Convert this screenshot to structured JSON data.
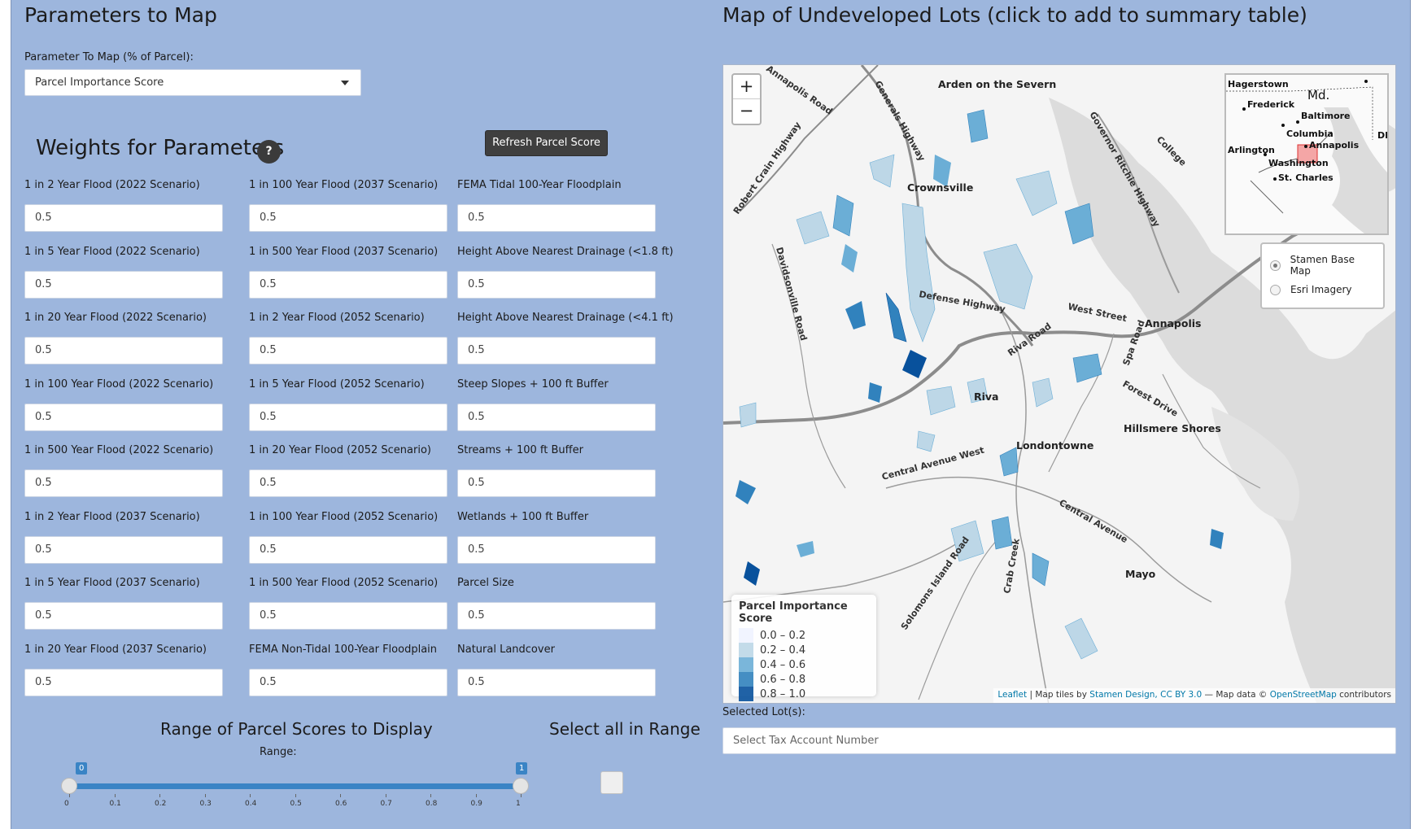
{
  "left_panel": {
    "title": "Parameters to Map",
    "param_select_label": "Parameter To Map (% of Parcel):",
    "param_select_value": "Parcel Importance Score",
    "weights_title": "Weights for Parameters",
    "help_label": "?",
    "refresh_button": "Refresh Parcel Score",
    "fields": [
      {
        "label": "1 in 2 Year Flood (2022 Scenario)",
        "value": "0.5"
      },
      {
        "label": "1 in 100 Year Flood (2037 Scenario)",
        "value": "0.5"
      },
      {
        "label": "FEMA Tidal 100-Year Floodplain",
        "value": "0.5"
      },
      {
        "label": "1 in 5 Year Flood (2022 Scenario)",
        "value": "0.5"
      },
      {
        "label": "1 in 500 Year Flood (2037 Scenario)",
        "value": "0.5"
      },
      {
        "label": "Height Above Nearest Drainage (<1.8 ft)",
        "value": "0.5"
      },
      {
        "label": "1 in 20 Year Flood (2022 Scenario)",
        "value": "0.5"
      },
      {
        "label": "1 in 2 Year Flood (2052 Scenario)",
        "value": "0.5"
      },
      {
        "label": "Height Above Nearest Drainage (<4.1 ft)",
        "value": "0.5"
      },
      {
        "label": "1 in 100 Year Flood (2022 Scenario)",
        "value": "0.5"
      },
      {
        "label": "1 in 5 Year Flood (2052 Scenario)",
        "value": "0.5"
      },
      {
        "label": "Steep Slopes + 100 ft Buffer",
        "value": "0.5"
      },
      {
        "label": "1 in 500 Year Flood (2022 Scenario)",
        "value": "0.5"
      },
      {
        "label": "1 in 20 Year Flood (2052 Scenario)",
        "value": "0.5"
      },
      {
        "label": "Streams + 100 ft Buffer",
        "value": "0.5"
      },
      {
        "label": "1 in 2 Year Flood (2037 Scenario)",
        "value": "0.5"
      },
      {
        "label": "1 in 100 Year Flood (2052 Scenario)",
        "value": "0.5"
      },
      {
        "label": "Wetlands + 100 ft Buffer",
        "value": "0.5"
      },
      {
        "label": "1 in 5 Year Flood (2037 Scenario)",
        "value": "0.5"
      },
      {
        "label": "1 in 500 Year Flood (2052 Scenario)",
        "value": "0.5"
      },
      {
        "label": "Parcel Size",
        "value": "0.5"
      },
      {
        "label": "1 in 20 Year Flood (2037 Scenario)",
        "value": "0.5"
      },
      {
        "label": "FEMA Non-Tidal 100-Year Floodplain",
        "value": "0.5"
      },
      {
        "label": "Natural Landcover",
        "value": "0.5"
      }
    ],
    "range_title": "Range of Parcel Scores to Display",
    "range_label": "Range:",
    "range_min_bubble": "0",
    "range_max_bubble": "1",
    "range_ticks": [
      "0",
      "0.1",
      "0.2",
      "0.3",
      "0.4",
      "0.5",
      "0.6",
      "0.7",
      "0.8",
      "0.9",
      "1"
    ],
    "select_all_title": "Select all in Range",
    "select_all_checked": false
  },
  "right_panel": {
    "title": "Map of Undeveloped Lots (click to add to summary table)",
    "zoom_in": "+",
    "zoom_out": "−",
    "place_labels": [
      "Arden on the Severn",
      "Crownsville",
      "Annapolis",
      "Riva",
      "Londontowne",
      "Hillsmere Shores",
      "Mayo"
    ],
    "road_labels": [
      "Annapolis Road",
      "Generals Highway",
      "Governor Ritchie Highway",
      "College",
      "Robert Crain Highway",
      "Davidsonville Road",
      "Defense Highway",
      "West Street",
      "Riva Road",
      "Spa Road",
      "Forest Drive",
      "Central Avenue West",
      "Central Avenue",
      "Solomons Island Road",
      "Crab Creek"
    ],
    "minimap_labels": [
      "Hagerstown",
      "Md.",
      "Frederick",
      "Baltimore",
      "Columbia",
      "Annapolis",
      "Arlington",
      "Washington",
      "St. Charles",
      "DE"
    ],
    "layers": [
      {
        "label": "Stamen Base Map",
        "selected": true
      },
      {
        "label": "Esri Imagery",
        "selected": false
      }
    ],
    "legend": {
      "title": "Parcel Importance Score",
      "items": [
        {
          "label": "0.0 – 0.2",
          "color": "#eff3ff"
        },
        {
          "label": "0.2 – 0.4",
          "color": "#bdd7e7"
        },
        {
          "label": "0.4 – 0.6",
          "color": "#6baed6"
        },
        {
          "label": "0.6 – 0.8",
          "color": "#3182bd"
        },
        {
          "label": "0.8 – 1.0",
          "color": "#08519c"
        }
      ]
    },
    "attribution": {
      "leaflet": "Leaflet",
      "sep1": " | Map tiles by ",
      "stamen": "Stamen Design, CC BY 3.0",
      "sep2": " — Map data © ",
      "osm": "OpenStreetMap",
      "tail": " contributors"
    },
    "selected_label": "Selected Lot(s):",
    "selected_placeholder": "Select Tax Account Number"
  }
}
